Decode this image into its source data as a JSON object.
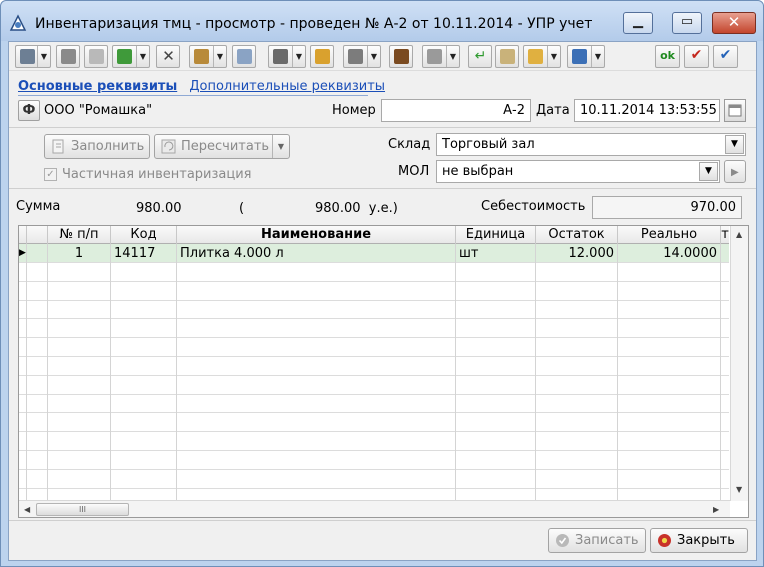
{
  "window": {
    "title": "Инвентаризация тмц - просмотр - проведен № А-2 от 10.11.2014 - УПР учет",
    "minimize_icon": "minimize-icon",
    "maximize_icon": "maximize-icon",
    "close_icon": "close-icon"
  },
  "toolbar": {
    "ok_label": "ok"
  },
  "tabs": {
    "main": "Основные реквизиты",
    "additional": "Дополнительные реквизиты"
  },
  "header": {
    "org_button": "Ф",
    "organization": "ООО \"Ромашка\"",
    "number_label": "Номер",
    "number_value": "А-2",
    "date_label": "Дата",
    "date_value": "10.11.2014 13:53:55"
  },
  "actions": {
    "fill_label": "Заполнить",
    "recalc_label": "Пересчитать",
    "partial_label": "Частичная инвентаризация",
    "partial_checked": true
  },
  "warehouse": {
    "label": "Склад",
    "value": "Торговый зал"
  },
  "mol": {
    "label": "МОЛ",
    "value": "не выбран"
  },
  "totals": {
    "sum_label": "Сумма",
    "sum_value": "980.00",
    "open_paren": "(",
    "cu_value": "980.00  у.е.)",
    "cost_label": "Себестоимость",
    "cost_value": "970.00"
  },
  "grid": {
    "columns": [
      "№ п/п",
      "Код",
      "Наименование",
      "Единица",
      "Остаток",
      "Реально",
      "т"
    ],
    "rows": [
      {
        "num": "1",
        "code": "14117",
        "name": "Плитка 4.000 л",
        "unit": "шт",
        "rest": "12.000",
        "real": "14.0000"
      }
    ],
    "scroll_thumb": "III"
  },
  "footer": {
    "save_label": "Записать",
    "close_label": "Закрыть"
  },
  "colors": {
    "selected_row": "#ddeedd",
    "link": "#1b4fb8",
    "window_frame": "#bcd3ee"
  }
}
